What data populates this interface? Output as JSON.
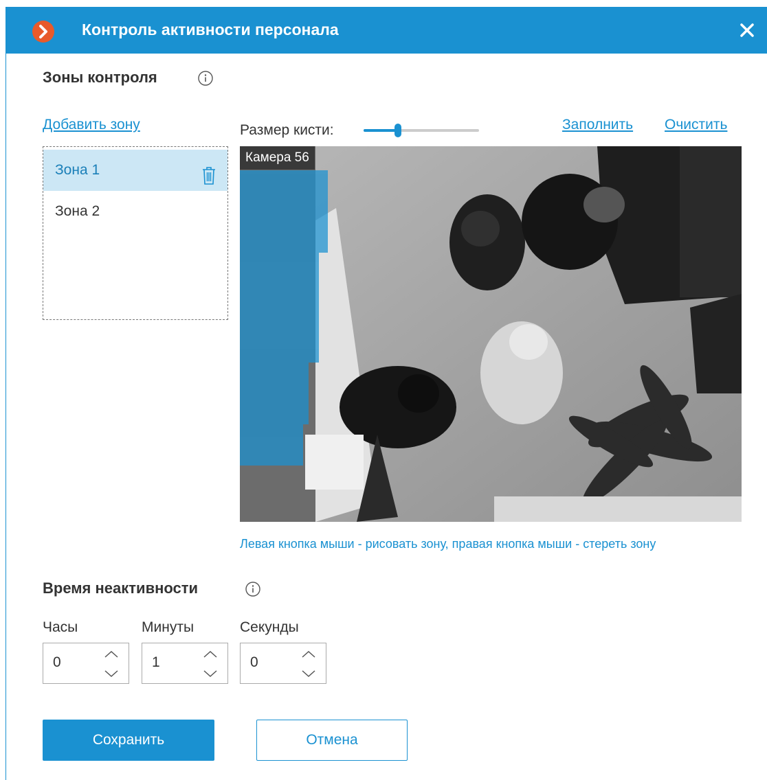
{
  "window": {
    "title": "Контроль активности персонала",
    "logo_icon": "macroscop-logo-icon",
    "close_icon": "close-icon"
  },
  "colors": {
    "accent": "#1a91d1",
    "logo": "#e85a2a",
    "selection": "#cce7f5"
  },
  "zones_section": {
    "title": "Зоны контроля",
    "info_icon": "info-icon",
    "add_zone_link": "Добавить зону",
    "zones": [
      {
        "label": "Зона 1",
        "selected": true
      },
      {
        "label": "Зона 2",
        "selected": false
      }
    ]
  },
  "brush": {
    "label": "Размер кисти:",
    "level": 0.3,
    "fill_link": "Заполнить",
    "clear_link": "Очистить"
  },
  "camera": {
    "name": "Камера 56"
  },
  "hint": "Левая кнопка мыши - рисовать зону, правая кнопка мыши - стереть зону",
  "inactivity": {
    "title": "Время неактивности",
    "fields": [
      {
        "label": "Часы",
        "value": "0"
      },
      {
        "label": "Минуты",
        "value": "1"
      },
      {
        "label": "Секунды",
        "value": "0"
      }
    ]
  },
  "buttons": {
    "save": "Сохранить",
    "cancel": "Отмена"
  }
}
